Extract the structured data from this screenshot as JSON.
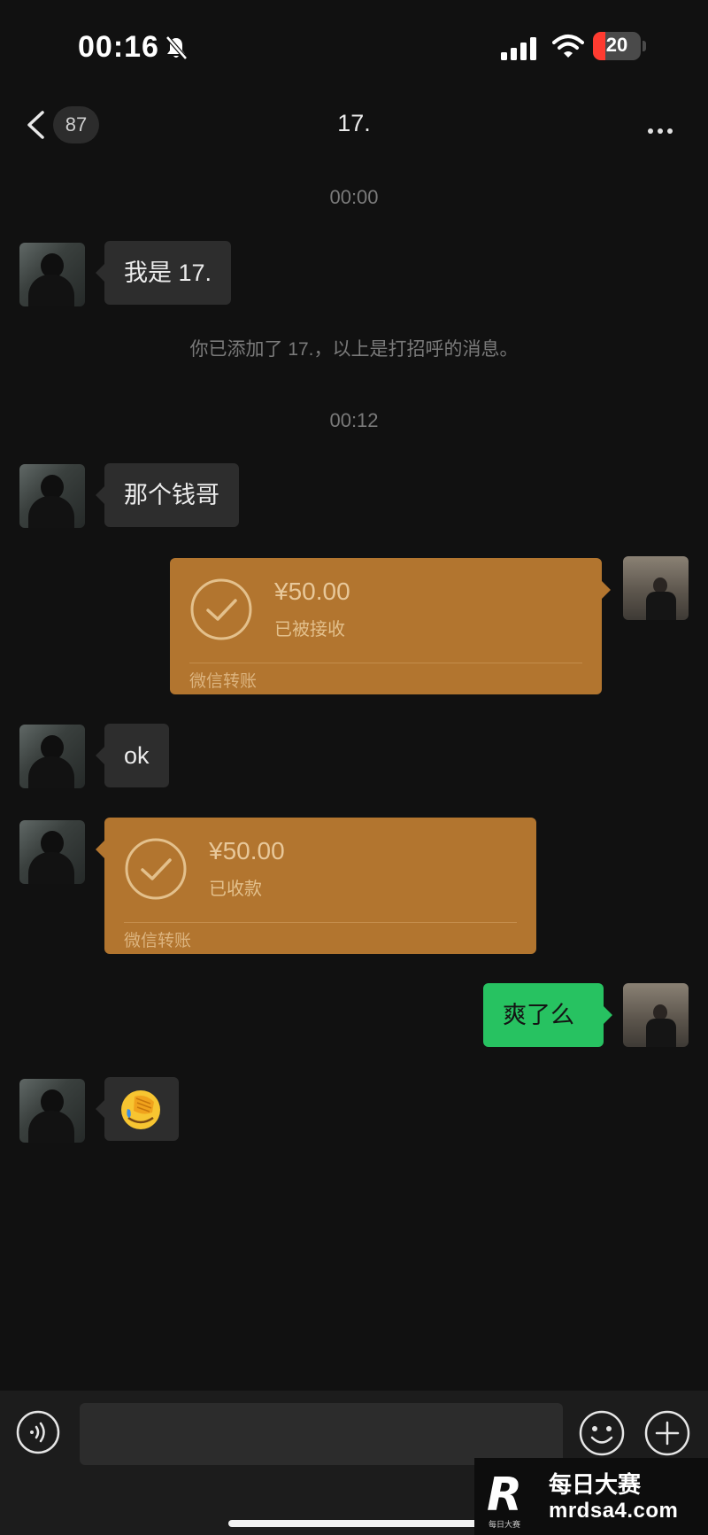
{
  "status_bar": {
    "time": "00:16",
    "battery": "20"
  },
  "header": {
    "unread_count": "87",
    "title": "17."
  },
  "messages": {
    "ts1": "00:00",
    "intro": "我是 17.",
    "system": "你已添加了 17.，以上是打招呼的消息。",
    "ts2": "00:12",
    "greeting": "那个钱哥",
    "transfer_sent": {
      "amount": "¥50.00",
      "status": "已被接收",
      "label": "微信转账"
    },
    "reply_ok": "ok",
    "transfer_received": {
      "amount": "¥50.00",
      "status": "已收款",
      "label": "微信转账"
    },
    "my_question": "爽了么",
    "reaction_emoji": "face-with-hand-over-eyes-crying"
  },
  "input": {
    "placeholder": ""
  },
  "watermark": {
    "title": "每日大赛",
    "url": "mrdsa4.com",
    "logo_letter": "R",
    "logo_sub": "每日大赛"
  },
  "colors": {
    "background": "#111111",
    "incoming_bubble": "#2d2d2d",
    "outgoing_bubble": "#27c261",
    "transfer_card": "#b2752f"
  }
}
